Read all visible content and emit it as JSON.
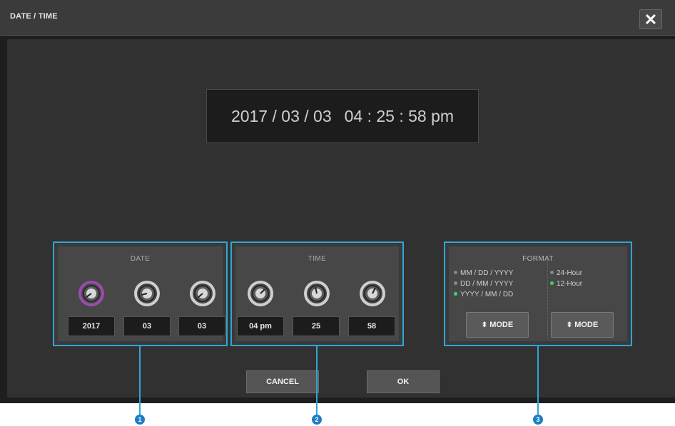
{
  "window": {
    "title": "DATE / TIME"
  },
  "display": {
    "date": "2017 / 03 / 03",
    "time": "04 : 25 : 58 pm"
  },
  "date_panel": {
    "label": "DATE",
    "fields": [
      {
        "value": "2017",
        "knob_color": "#9b4ab0",
        "selected": true
      },
      {
        "value": "03",
        "knob_color": "#cfcfcf",
        "selected": false
      },
      {
        "value": "03",
        "knob_color": "#cfcfcf",
        "selected": false
      }
    ]
  },
  "time_panel": {
    "label": "TIME",
    "fields": [
      {
        "value": "04 pm",
        "knob_color": "#cfcfcf",
        "selected": false
      },
      {
        "value": "25",
        "knob_color": "#cfcfcf",
        "selected": false
      },
      {
        "value": "58",
        "knob_color": "#cfcfcf",
        "selected": false
      }
    ]
  },
  "format_panel": {
    "label": "FORMAT",
    "date_formats": [
      {
        "label": "MM / DD / YYYY",
        "active": false
      },
      {
        "label": "DD / MM / YYYY",
        "active": false
      },
      {
        "label": "YYYY / MM / DD",
        "active": true
      }
    ],
    "hour_formats": [
      {
        "label": "24-Hour",
        "active": false
      },
      {
        "label": "12-Hour",
        "active": true
      }
    ],
    "mode_label": "MODE"
  },
  "buttons": {
    "cancel": "CANCEL",
    "ok": "OK"
  },
  "callouts": [
    "1",
    "2",
    "3"
  ],
  "colors": {
    "highlight": "#2fa6d4",
    "active_dot": "#3fd46a",
    "callout": "#1a7ec4"
  }
}
